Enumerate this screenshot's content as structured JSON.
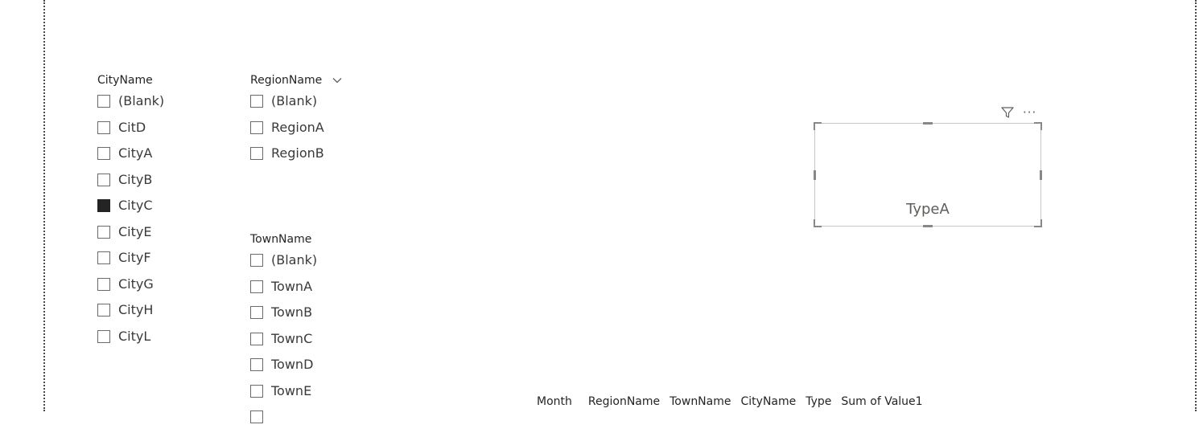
{
  "slicers": {
    "city": {
      "title": "CityName",
      "items": [
        {
          "label": "(Blank)",
          "checked": false
        },
        {
          "label": "CitD",
          "checked": false
        },
        {
          "label": "CityA",
          "checked": false
        },
        {
          "label": "CityB",
          "checked": false
        },
        {
          "label": "CityC",
          "checked": true
        },
        {
          "label": "CityE",
          "checked": false
        },
        {
          "label": "CityF",
          "checked": false
        },
        {
          "label": "CityG",
          "checked": false
        },
        {
          "label": "CityH",
          "checked": false
        },
        {
          "label": "CityL",
          "checked": false
        }
      ]
    },
    "region": {
      "title": "RegionName",
      "items": [
        {
          "label": "(Blank)",
          "checked": false
        },
        {
          "label": "RegionA",
          "checked": false
        },
        {
          "label": "RegionB",
          "checked": false
        }
      ]
    },
    "town": {
      "title": "TownName",
      "items": [
        {
          "label": "(Blank)",
          "checked": false
        },
        {
          "label": "TownA",
          "checked": false
        },
        {
          "label": "TownB",
          "checked": false
        },
        {
          "label": "TownC",
          "checked": false
        },
        {
          "label": "TownD",
          "checked": false
        },
        {
          "label": "TownE",
          "checked": false
        }
      ]
    }
  },
  "card": {
    "value": "TypeA",
    "toolbar": {
      "filter_icon": "filter-icon",
      "more_label": "···"
    }
  },
  "table": {
    "columns": [
      "Month",
      "RegionName",
      "TownName",
      "CityName",
      "Type",
      "Sum of Value1"
    ]
  },
  "colors": {
    "checked": "#252423",
    "border": "#c6c6c6"
  }
}
